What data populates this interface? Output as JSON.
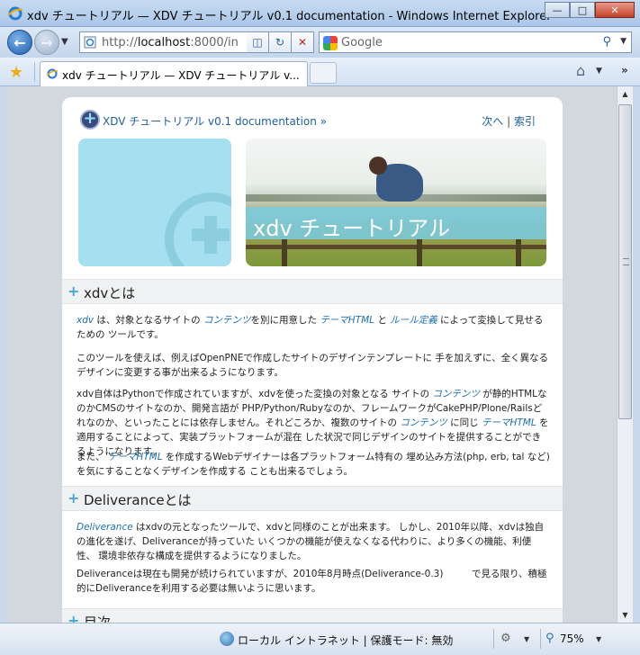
{
  "window": {
    "title": "xdv チュートリアル — XDV チュートリアル v0.1 documentation - Windows Internet Explorer",
    "min_label": "—",
    "max_label": "□",
    "close_label": "✕"
  },
  "address": {
    "url_prefix": "http://",
    "url_host": "localhost",
    "url_rest": ":8000/in"
  },
  "search": {
    "provider": "Google"
  },
  "tab": {
    "label": "xdv チュートリアル — XDV チュートリアル v..."
  },
  "page": {
    "doc_link": "XDV チュートリアル v0.1 documentation »",
    "nav_next": "次へ",
    "nav_sep": "|",
    "nav_index": "索引",
    "banner_caption": "xdv チュートリアル",
    "sections": [
      {
        "heading": "xdvとは"
      },
      {
        "heading": "Deliveranceとは"
      },
      {
        "heading": "目次"
      }
    ],
    "p1": {
      "t1": "xdv",
      "s1": " は、対象となるサイトの ",
      "t2": "コンテンツ",
      "s2": "を別に用意した ",
      "t3": "テーマHTML",
      "s3": " と ",
      "t4": "ルール定義",
      "s4": " によって変換して見せるための ツールです。"
    },
    "p2": "このツールを使えば、例えばOpenPNEで作成したサイトのデザインテンプレートに 手を加えずに、全く異なるデザインに変更する事が出来るようになります。",
    "p3": {
      "s1": "xdv自体はPythonで作成されていますが、xdvを使った変換の対象となる サイトの ",
      "t1": "コンテンツ",
      "s2": " が静的HTMLなのかCMSのサイトなのか、開発言語が PHP/Python/Rubyなのか、フレームワークがCakePHP/Plone/Railsどれなのか、といったことには依存しません。それどころか、複数のサイトの ",
      "t2": "コンテンツ",
      "s3": " に同じ ",
      "t3": "テーマHTML",
      "s4": " を適用することによって、実装プラットフォームが混在 した状況で同じデザインのサイトを提供することができるようになります。"
    },
    "p4": {
      "s1": "また、 ",
      "t1": "テーマHTML",
      "s2": " を作成するWebデザイナーは各プラットフォーム特有の 埋め込み方法(php, erb, tal など)を気にすることなくデザインを作成する ことも出来るでしょう。"
    },
    "p5": {
      "t1": "Deliverance",
      "s1": " はxdvの元となったツールで、xdvと同様のことが出来ます。 しかし、2010年以降、xdvは独自の進化を遂げ、Deliveranceが持っていた いくつかの機能が使えなくなる代わりに、より多くの機能、利便性、 環境非依存な構成を提供するようになりました。"
    },
    "p6": "Deliveranceは現在も開発が続けられていますが、2010年8月時点(Deliverance-0.3)　　　で見る限り、積極的にDeliveranceを利用する必要は無いように思います。"
  },
  "status": {
    "zone": "ローカル イントラネット | 保護モード: 無効",
    "zoom": "75%"
  },
  "colors": {
    "link": "#1f5f9a",
    "term": "#1f6fb0",
    "banner_caption_bg": "#78cee8"
  }
}
